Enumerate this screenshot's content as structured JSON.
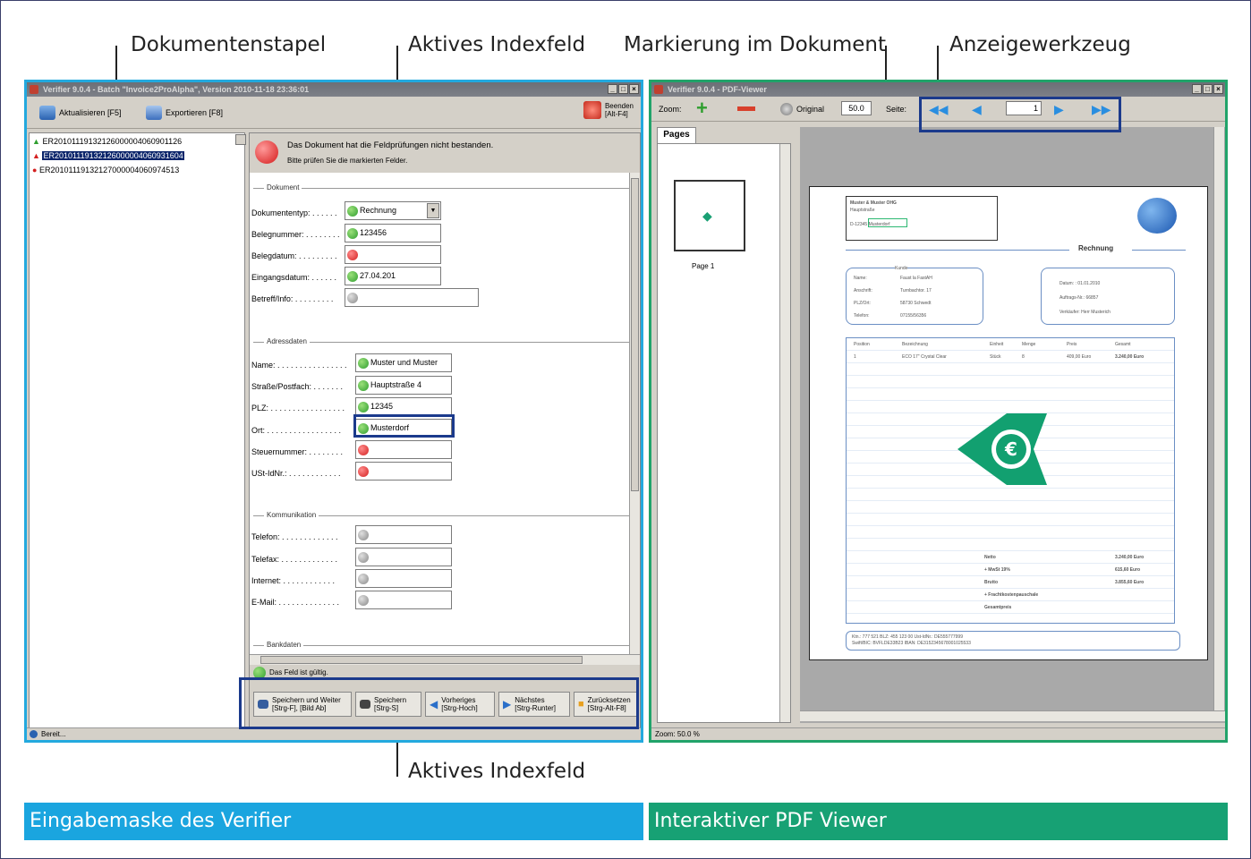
{
  "callouts": {
    "top1": "Dokumentenstapel",
    "top2": "Aktives Indexfeld",
    "top3": "Markierung im Dokument",
    "top4": "Anzeigewerkzeug",
    "bottom": "Aktives Indexfeld"
  },
  "banners": {
    "left": "Eingabemaske des Verifier",
    "right": "Interaktiver PDF Viewer",
    "left_color": "#1aa5df",
    "right_color": "#17a174"
  },
  "verifier": {
    "title": "Verifier 9.0.4 - Batch \"Invoice2ProAlpha\", Version 2010-11-18 23:36:01",
    "toolbar": {
      "refresh": "Aktualisieren [F5]",
      "export": "Exportieren [F8]",
      "quit_line1": "Beenden",
      "quit_line2": "[Alt-F4]"
    },
    "documents": [
      "ER20101119132126000004060901126",
      "ER20101119132126000004060931604",
      "ER20101119132127000004060974513"
    ],
    "message_line1": "Das Dokument hat die Feldprüfungen nicht bestanden.",
    "message_line2": "Bitte prüfen Sie die markierten Felder.",
    "groups": {
      "dokument": "Dokument",
      "adressdaten": "Adressdaten",
      "kommunikation": "Kommunikation",
      "bankdaten": "Bankdaten"
    },
    "fields": {
      "dokumententyp_label": "Dokumententyp: . . . . . .",
      "dokumententyp_value": "Rechnung",
      "belegnummer_label": "Belegnummer: . . . . . . . .",
      "belegnummer_value": "123456",
      "belegdatum_label": "Belegdatum: . . . . . . . . .",
      "eingangsdatum_label": "Eingangsdatum: . . . . . .",
      "eingangsdatum_value": "27.04.201",
      "betreff_label": "Betreff/Info: . . . . . . . . .",
      "name_label": "Name: . . . . . . . . . . . . . . . .",
      "name_value": "Muster und Muster",
      "strasse_label": "Straße/Postfach: . . . . . . .",
      "strasse_value": "Hauptstraße 4",
      "plz_label": "PLZ: . . . . . . . . . . . . . . . . .",
      "plz_value": "12345",
      "ort_label": "Ort: . . . . . . . . . . . . . . . . .",
      "ort_value": "Musterdorf",
      "steuer_label": "Steuernummer: . . . . . . . .",
      "ust_label": "USt-IdNr.: . . . . . . . . . . . .",
      "telefon_label": "Telefon: . . . . . . . . . . . . .",
      "telefax_label": "Telefax: . . . . . . . . . . . . .",
      "internet_label": "Internet: . . . . . . . . . . . .",
      "email_label": "E-Mail: . . . . . . . . . . . . . ."
    },
    "field_status": "Das Feld ist gültig.",
    "buttons": {
      "save_next_1": "Speichern und Weiter",
      "save_next_2": "[Strg-F], [Bild Ab]",
      "save_1": "Speichern",
      "save_2": "[Strg-S]",
      "prev_1": "Vorheriges",
      "prev_2": "[Strg-Hoch]",
      "next_1": "Nächstes",
      "next_2": "[Strg-Runter]",
      "reset_1": "Zurücksetzen",
      "reset_2": "[Strg-Alt-F8]"
    },
    "status": "Bereit..."
  },
  "viewer": {
    "title": "Verifier 9.0.4 - PDF-Viewer",
    "zoom_label": "Zoom:",
    "original_label": "Original",
    "zoom_value": "50.0",
    "page_label": "Seite:",
    "page_value": "1",
    "pages_tab": "Pages",
    "thumb_label": "Page 1",
    "status": "Zoom: 50.0 %",
    "doc": {
      "company": "Muster & Muster OHG",
      "street": "Hauptstraße",
      "city": "D-12345 Musterdorf",
      "heading": "Rechnung",
      "kunde": "Kunde",
      "c_name_l": "Name:",
      "c_name_v": "Faust la FastAH",
      "c_addr_l": "Anschrift:",
      "c_addr_v": "Turnbachtor. 17",
      "c_plz_l": "PLZ/Ort:",
      "c_plz_v": "58730 Schwedt",
      "c_tel_l": "Telefon:",
      "c_tel_v": "07155/56356",
      "datum": "Datum: : 01.01.2010",
      "auftrag": "Auftrags-Nr.: 66857",
      "verkaeufer": "Verkäufer: Herr Musterich",
      "cols": [
        "Position",
        "Bezeichnung",
        "Einheit",
        "Menge",
        "Preis",
        "Gesamt"
      ],
      "row1": [
        "1",
        "ECO 17\" Crystal Clear",
        "Stück",
        "8",
        "409,00 Euro",
        "3.240,00 Euro"
      ],
      "netto_l": "Netto",
      "netto_v": "3.240,00 Euro",
      "mwst_l": "+ MwSt 19%",
      "mwst_v": "615,60 Euro",
      "brutto_l": "Brutto",
      "brutto_v": "3.855,60 Euro",
      "fracht_l": "+ Frachtkostenpauschale",
      "gesamt_l": "Gesamtpreis",
      "footer1": "Ktn.: 777 521      BLZ: 455 123 00      Ust-IdNr.: DE555777999",
      "footer2": "Swift/BIC: BVFLDE33B23   IBAN: DE3152345678001025533"
    }
  }
}
